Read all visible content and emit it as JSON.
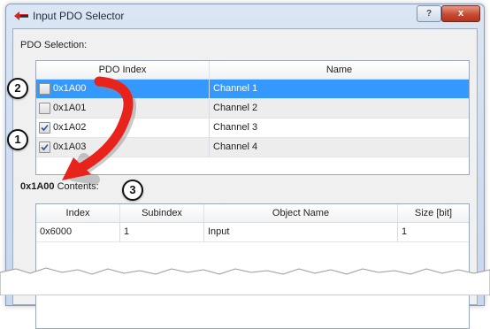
{
  "window": {
    "title": "Input PDO Selector",
    "help_label": "?",
    "close_label": "x"
  },
  "pdo_selection": {
    "label": "PDO Selection:",
    "columns": [
      "PDO Index",
      "Name"
    ],
    "rows": [
      {
        "index": "0x1A00",
        "name": "Channel 1",
        "checked": false,
        "selected": true
      },
      {
        "index": "0x1A01",
        "name": "Channel 2",
        "checked": false,
        "selected": false
      },
      {
        "index": "0x1A02",
        "name": "Channel 3",
        "checked": true,
        "selected": false
      },
      {
        "index": "0x1A03",
        "name": "Channel 4",
        "checked": true,
        "selected": false
      }
    ]
  },
  "contents": {
    "label_bold": "0x1A00",
    "label_rest": " Contents:",
    "columns": [
      "Index",
      "Subindex",
      "Object Name",
      "Size [bit]"
    ],
    "rows": [
      {
        "index": "0x6000",
        "subindex": "1",
        "object_name": "Input",
        "size": "1"
      }
    ]
  },
  "annotations": {
    "badge_1": "1",
    "badge_2": "2",
    "badge_3": "3",
    "arrow_color": "#e8231b"
  }
}
